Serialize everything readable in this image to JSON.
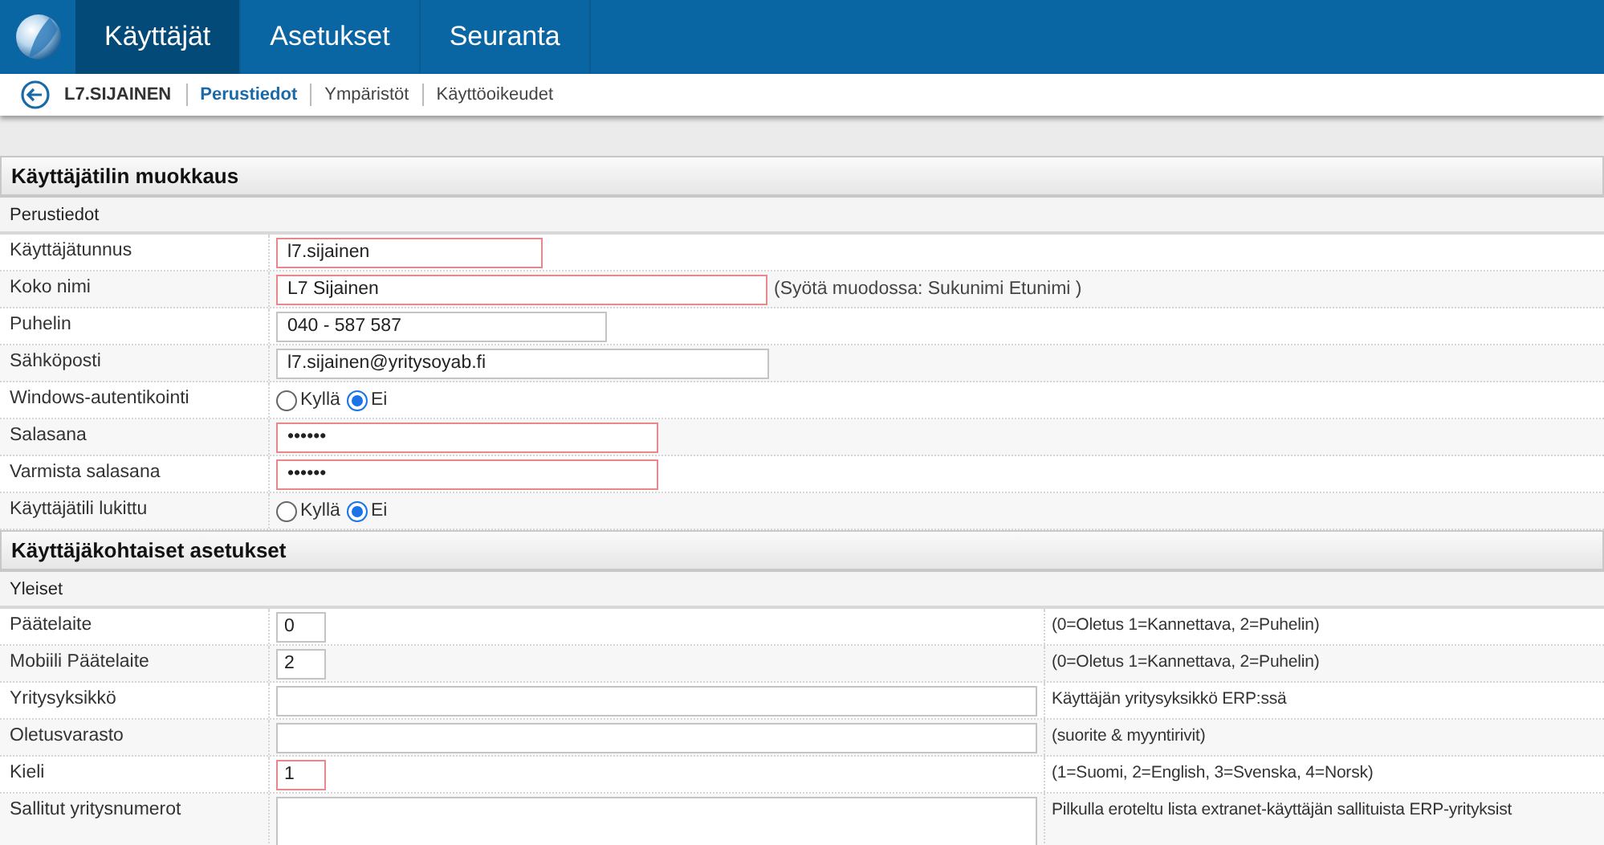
{
  "top_nav": {
    "tabs": [
      {
        "label": "Käyttäjät",
        "selected": true
      },
      {
        "label": "Asetukset",
        "selected": false
      },
      {
        "label": "Seuranta",
        "selected": false
      }
    ]
  },
  "sub_nav": {
    "title": "L7.SIJAINEN",
    "links": [
      {
        "label": "Perustiedot",
        "selected": true
      },
      {
        "label": "Ympäristöt",
        "selected": false
      },
      {
        "label": "Käyttöoikeudet",
        "selected": false
      }
    ]
  },
  "sections": [
    {
      "title": "Käyttäjätilin muokkaus",
      "groups": [
        {
          "title": "Perustiedot",
          "rows": [
            {
              "kind": "text",
              "label": "Käyttäjätunnus",
              "value": "l7.sijainen",
              "error": true
            },
            {
              "kind": "text",
              "label": "Koko nimi",
              "value": "L7 Sijainen",
              "error": true,
              "hint": "(Syötä muodossa: Sukunimi Etunimi )"
            },
            {
              "kind": "text",
              "label": "Puhelin",
              "value": "040 - 587 587",
              "error": false
            },
            {
              "kind": "text",
              "label": "Sähköposti",
              "value": "l7.sijainen@yritysoyab.fi",
              "error": false
            },
            {
              "kind": "radio",
              "label": "Windows-autentikointi",
              "options": [
                {
                  "label": "Kyllä",
                  "selected": false
                },
                {
                  "label": "Ei",
                  "selected": true
                }
              ]
            },
            {
              "kind": "password",
              "label": "Salasana",
              "value": "••••••",
              "error": true
            },
            {
              "kind": "password",
              "label": "Varmista salasana",
              "value": "••••••",
              "error": true
            },
            {
              "kind": "radio",
              "label": "Käyttäjätili lukittu",
              "options": [
                {
                  "label": "Kyllä",
                  "selected": false
                },
                {
                  "label": "Ei",
                  "selected": true
                }
              ]
            }
          ]
        }
      ]
    },
    {
      "title": "Käyttäjäkohtaiset asetukset",
      "groups": [
        {
          "title": "Yleiset",
          "rows": [
            {
              "kind": "setting",
              "label": "Päätelaite",
              "value": "0",
              "error": false,
              "note": "(0=Oletus 1=Kannettava, 2=Puhelin)"
            },
            {
              "kind": "setting",
              "label": "Mobiili Päätelaite",
              "value": "2",
              "error": false,
              "note": "(0=Oletus 1=Kannettava, 2=Puhelin)"
            },
            {
              "kind": "setting",
              "label": "Yritysyksikkö",
              "error": false,
              "note": "Käyttäjän yritysyksikkö ERP:ssä"
            },
            {
              "kind": "setting",
              "label": "Oletusvarasto",
              "error": false,
              "note": "(suorite & myyntirivit)"
            },
            {
              "kind": "setting",
              "label": "Kieli",
              "value": "1",
              "error": true,
              "note": "(1=Suomi, 2=English, 3=Svenska, 4=Norsk)"
            },
            {
              "kind": "textarea",
              "label": "Sallitut yritysnumerot",
              "error": false,
              "note": "Pilkulla eroteltu lista extranet-käyttäjän sallituista ERP-yrityksist"
            }
          ]
        }
      ]
    }
  ]
}
